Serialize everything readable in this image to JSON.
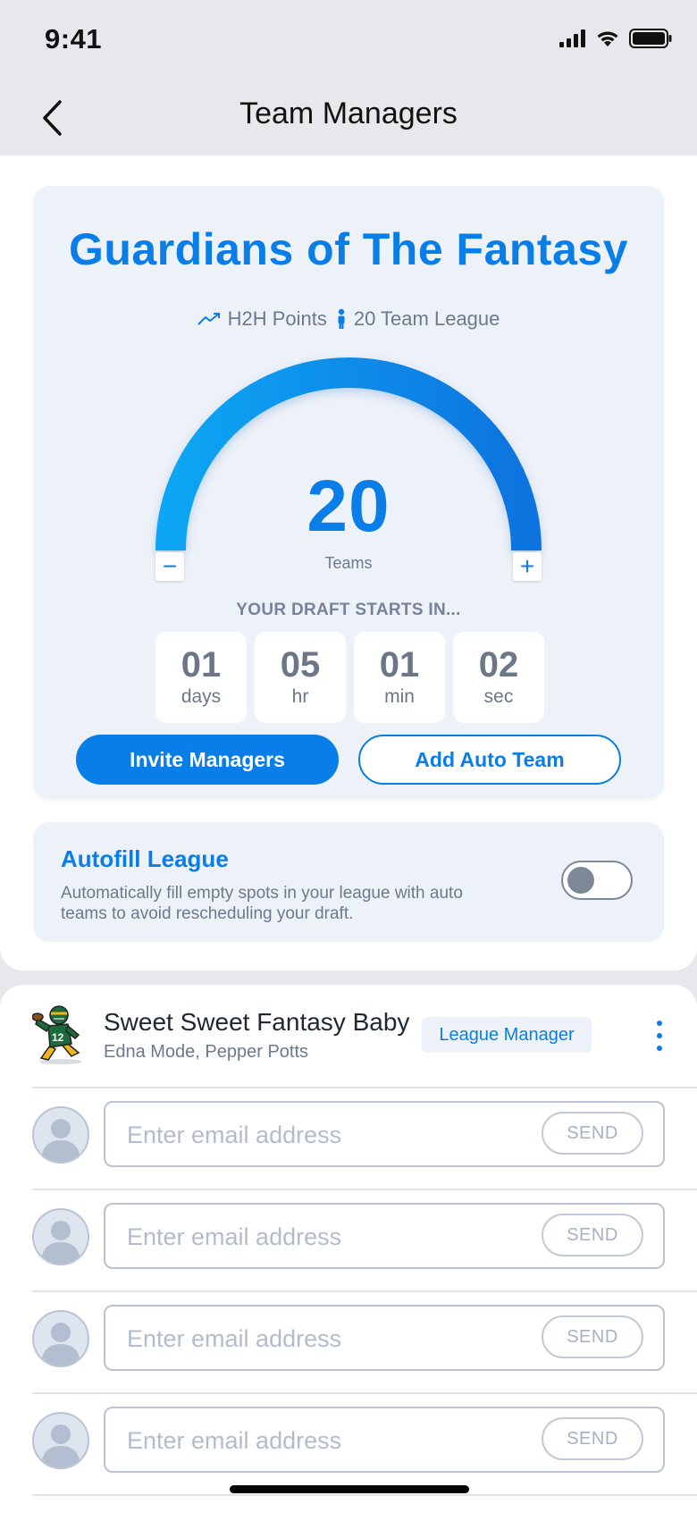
{
  "status_bar": {
    "time": "9:41"
  },
  "nav": {
    "title": "Team Managers"
  },
  "league": {
    "name": "Guardians of The Fantasy",
    "scoring": "H2H Points",
    "size_label": "20 Team League",
    "teams_count": "20",
    "teams_label": "Teams",
    "minus_symbol": "−",
    "plus_symbol": "+",
    "draft_label": "YOUR DRAFT STARTS IN...",
    "countdown": [
      {
        "value": "01",
        "unit": "days"
      },
      {
        "value": "05",
        "unit": "hr"
      },
      {
        "value": "01",
        "unit": "min"
      },
      {
        "value": "02",
        "unit": "sec"
      }
    ],
    "invite_label": "Invite Managers",
    "auto_team_label": "Add Auto Team"
  },
  "autofill": {
    "title": "Autofill League",
    "description": "Automatically fill empty spots in your league with auto teams to avoid rescheduling your draft.",
    "enabled": false
  },
  "team": {
    "name": "Sweet Sweet Fantasy Baby",
    "managers": "Edna Mode, Pepper Potts",
    "role": "League Manager",
    "jersey_number": "12"
  },
  "invites": [
    {
      "placeholder": "Enter email address",
      "send_label": "SEND"
    },
    {
      "placeholder": "Enter email address",
      "send_label": "SEND"
    },
    {
      "placeholder": "Enter email address",
      "send_label": "SEND"
    },
    {
      "placeholder": "Enter email address",
      "send_label": "SEND"
    }
  ],
  "colors": {
    "accent": "#0a7ee8",
    "card_bg": "#edf1f8",
    "muted_text": "#6b7a8d"
  }
}
